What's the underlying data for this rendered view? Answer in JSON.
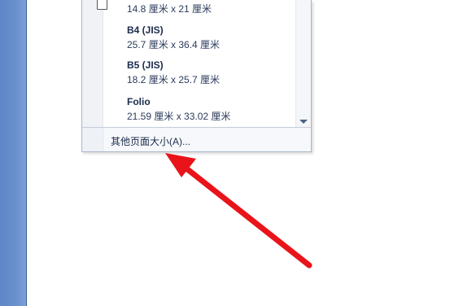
{
  "paper_sizes": [
    {
      "name": "",
      "dims": "14.8 厘米 x 21 厘米"
    },
    {
      "name": "B4 (JIS)",
      "dims": "25.7 厘米 x 36.4 厘米"
    },
    {
      "name": "B5 (JIS)",
      "dims": "18.2 厘米 x 25.7 厘米"
    },
    {
      "name": "Folio",
      "dims": "21.59 厘米 x 33.02 厘米"
    }
  ],
  "footer": {
    "more_sizes_label": "其他页面大小(A)..."
  },
  "colors": {
    "arrow": "#e8141a",
    "rail": "#6a90cc",
    "text": "#1b2b4b"
  }
}
